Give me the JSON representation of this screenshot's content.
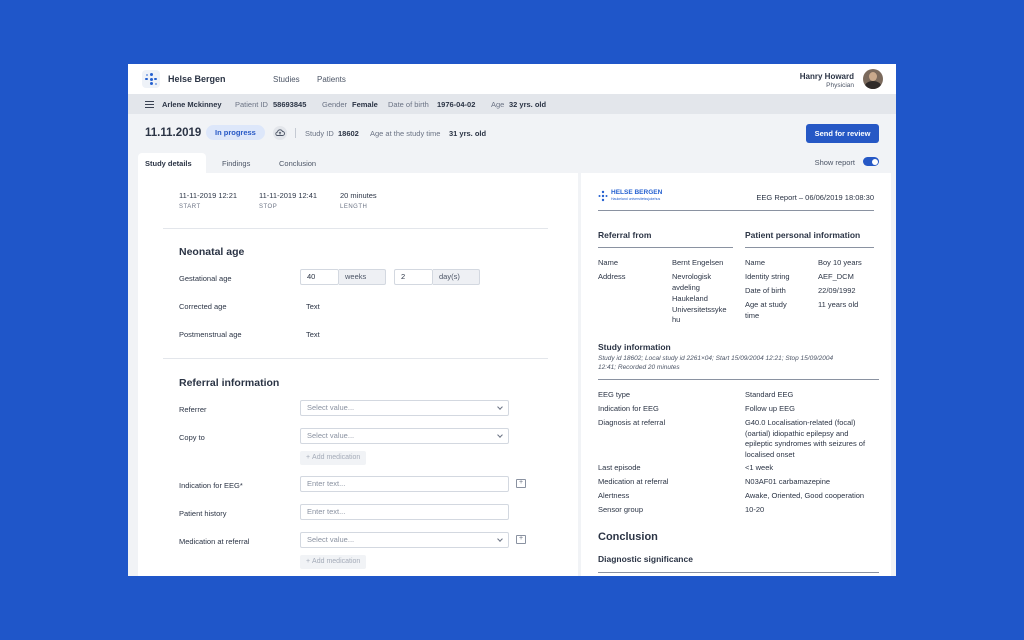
{
  "app": {
    "brand": "Helse Bergen",
    "nav": [
      "Studies",
      "Patients"
    ],
    "user": {
      "name": "Hanry Howard",
      "role": "Physician"
    }
  },
  "patient": {
    "name": "Arlene Mckinney",
    "id_label": "Patient ID",
    "id": "58693845",
    "gender_label": "Gender",
    "gender": "Female",
    "dob_label": "Date of birth",
    "dob": "1976-04-02",
    "age_label": "Age",
    "age": "32 yrs. old"
  },
  "study": {
    "date": "11.11.2019",
    "status": "In progress",
    "id_label": "Study ID",
    "id": "18602",
    "age_label": "Age at the study time",
    "age": "31 yrs. old",
    "send_button": "Send for review"
  },
  "tabs": [
    "Study details",
    "Findings",
    "Conclusion"
  ],
  "show_report_label": "Show report",
  "timing": {
    "start": "11-11-2019 12:21",
    "start_label": "START",
    "stop": "11-11-2019 12:41",
    "stop_label": "STOP",
    "length": "20 minutes",
    "length_label": "LENGTH"
  },
  "neonatal": {
    "title": "Neonatal age",
    "gestational_label": "Gestational age",
    "weeks_value": "40",
    "weeks_unit": "weeks",
    "days_value": "2",
    "days_unit": "day(s)",
    "corrected_label": "Corrected age",
    "corrected_value": "Text",
    "postmenstrual_label": "Postmenstrual age",
    "postmenstrual_value": "Text"
  },
  "referral": {
    "title": "Referral information",
    "referrer_label": "Referrer",
    "referrer_placeholder": "Select value...",
    "copy_label": "Copy to",
    "copy_placeholder": "Select value...",
    "add_medication": "Add medication",
    "indication_label": "Indication for EEG*",
    "indication_placeholder": "Enter text...",
    "history_label": "Patient history",
    "history_placeholder": "Enter text...",
    "medication_label": "Medication at referral",
    "medication_placeholder": "Select value..."
  },
  "report": {
    "logo_title": "HELSE BERGEN",
    "logo_sub": "Haukeland universitetssjukehus",
    "header": "EEG Report – 06/06/2019 18:08:30",
    "referral_from": "Referral from",
    "patient_info": "Patient personal information",
    "ref_name_label": "Name",
    "ref_name": "Bernt Engelsen",
    "ref_address_label": "Address",
    "ref_address": [
      "Nevrologisk",
      "avdeling",
      "Haukeland",
      "Universitetssyke",
      "hu"
    ],
    "pat_name_label": "Name",
    "pat_name": "Boy 10 years",
    "pat_identity_label": "Identity string",
    "pat_identity": "AEF_DCM",
    "pat_dob_label": "Date of birth",
    "pat_dob": "22/09/1992",
    "pat_age_label_1": "Age at study",
    "pat_age_label_2": "time",
    "pat_age": "11 years old",
    "study_info_title": "Study information",
    "study_info_line1": "Study id 18602; Local study id 2261×04; Start 15/09/2004 12:21; Stop 15/09/2004",
    "study_info_line2": "12:41; Recorded 20 minutes",
    "rows": [
      {
        "label": "EEG type",
        "value": "Standard EEG"
      },
      {
        "label": "Indication for EEG",
        "value": "Follow up EEG"
      },
      {
        "label": "Diagnosis at referral",
        "value_lines": [
          "G40.0 Localisation-related (focal)",
          "(oartial) idiopathic epilepsy and",
          "epileptic syndromes with seizures of",
          "localised onset"
        ]
      },
      {
        "label": "Last episode",
        "value": "<1 week"
      },
      {
        "label": "Medication at referral",
        "value": "N03AF01 carbamazepine"
      },
      {
        "label": "Alertness",
        "value": "Awake, Oriented, Good cooperation"
      },
      {
        "label": "Sensor group",
        "value": "10-20"
      }
    ],
    "conclusion_title": "Conclusion",
    "diagnostic_significance": "Diagnostic significance"
  }
}
